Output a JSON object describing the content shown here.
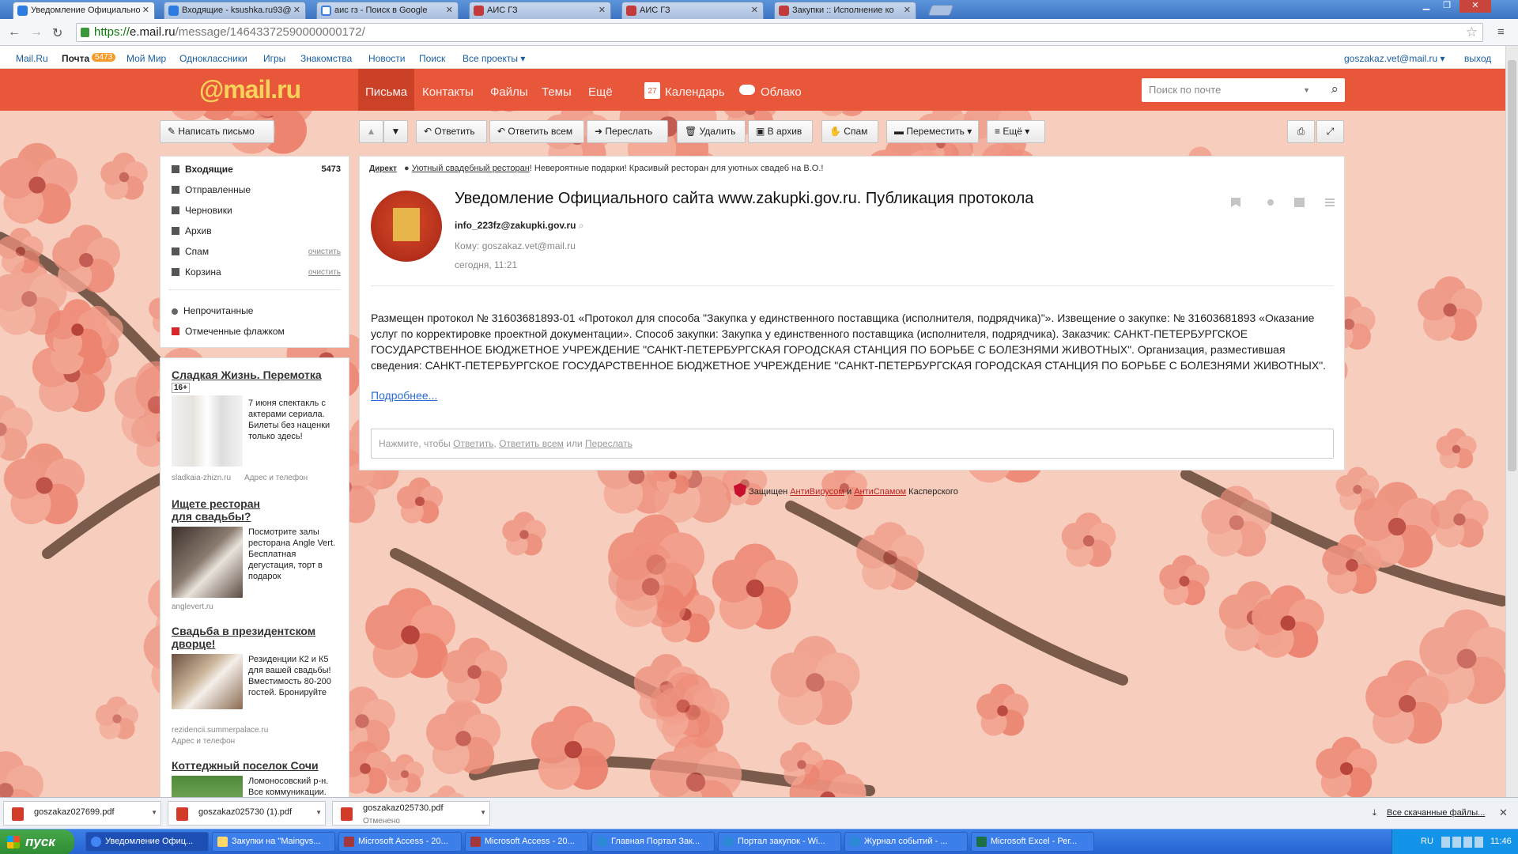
{
  "browser": {
    "tabs": [
      {
        "label": "Уведомление Официально",
        "active": true,
        "icon": "mailru-icon"
      },
      {
        "label": "Входящие - ksushka.ru93@",
        "active": false,
        "icon": "mailru-icon"
      },
      {
        "label": "аис гз - Поиск в Google",
        "active": false,
        "icon": "google-icon"
      },
      {
        "label": "АИС ГЗ",
        "active": false,
        "icon": "ais-icon"
      },
      {
        "label": "АИС ГЗ",
        "active": false,
        "icon": "ais-icon"
      },
      {
        "label": "Закупки :: Исполнение ко",
        "active": false,
        "icon": "ais-icon"
      }
    ],
    "url_scheme": "https://",
    "url_host": "e.mail.ru",
    "url_path": "/message/14643372590000000172/"
  },
  "portal": {
    "links": [
      "Mail.Ru",
      "Почта",
      "Мой Мир",
      "Одноклассники",
      "Игры",
      "Знакомства",
      "Новости",
      "Поиск",
      "Все проекты ▾"
    ],
    "mail_count": "5473",
    "user": "goszakaz.vet@mail.ru ▾",
    "logout": "выход"
  },
  "header": {
    "logo": "@mail.ru",
    "nav": [
      "Письма",
      "Контакты",
      "Файлы",
      "Темы",
      "Ещё"
    ],
    "calendar": "Календарь",
    "calendar_day": "27",
    "cloud": "Облако",
    "search_placeholder": "Поиск по почте"
  },
  "toolbar": {
    "compose": "Написать письмо",
    "reply": "Ответить",
    "reply_all": "Ответить всем",
    "forward": "Переслать",
    "delete": "Удалить",
    "archive": "В архив",
    "spam": "Спам",
    "move": "Переместить ▾",
    "more": "≡ Ещё ▾"
  },
  "folders": {
    "inbox": "Входящие",
    "inbox_count": "5473",
    "sent": "Отправленные",
    "drafts": "Черновики",
    "archive": "Архив",
    "spam": "Спам",
    "trash": "Корзина",
    "clear": "очистить",
    "unread": "Непрочитанные",
    "flagged": "Отмеченные флажком"
  },
  "ads": [
    {
      "title": "Сладкая Жизнь. Перемотка",
      "age": "16+",
      "text": "7 июня спектакль с актерами сериала. Билеты без наценки только здесь!",
      "domain": "sladkaia-zhizn.ru",
      "extra": "Адрес и телефон"
    },
    {
      "title": "Ищете ресторан для свадьбы?",
      "text": "Посмотрите залы ресторана Angle Vert. Бесплатная дегустация, торт в подарок",
      "domain": "anglevert.ru"
    },
    {
      "title": "Свадьба в президентском дворце!",
      "text": "Резиденции К2 и К5 для вашей свадьбы! Вместимость 80-200 гостей. Бронируйте",
      "domain": "rezidencii.summerpalace.ru",
      "extra": "Адрес и телефон"
    },
    {
      "title": "Коттеджный поселок Сочи",
      "text": "Ломоносовский р-н. Все коммуникации."
    }
  ],
  "message": {
    "direct_label": "Директ",
    "direct_link": "Уютный свадебный ресторан",
    "direct_text": "! Невероятные подарки! Красивый ресторан для уютных свадеб на В.О.!",
    "subject": "Уведомление Официального сайта www.zakupki.gov.ru. Публикация протокола",
    "from": "info_223fz@zakupki.gov.ru",
    "to": "Кому: goszakaz.vet@mail.ru",
    "date": "сегодня, 11:21",
    "body": "Размещен протокол № 31603681893-01 «Протокол для способа \"Закупка у единственного поставщика (исполнителя, подрядчика)\"». Извещение о закупке: № 31603681893 «Оказание услуг по корректировке проектной документации». Способ закупки: Закупка у единственного поставщика (исполнителя, подрядчика). Заказчик: САНКТ-ПЕТЕРБУРГСКОЕ ГОСУДАРСТВЕННОЕ БЮДЖЕТНОЕ УЧРЕЖДЕНИЕ \"САНКТ-ПЕТЕРБУРГСКАЯ ГОРОДСКАЯ СТАНЦИЯ ПО БОРЬБЕ С БОЛЕЗНЯМИ ЖИВОТНЫХ\". Организация, разместившая сведения: САНКТ-ПЕТЕРБУРГСКОЕ ГОСУДАРСТВЕННОЕ БЮДЖЕТНОЕ УЧРЕЖДЕНИЕ \"САНКТ-ПЕТЕРБУРГСКАЯ ГОРОДСКАЯ СТАНЦИЯ ПО БОРЬБЕ С БОЛЕЗНЯМИ ЖИВОТНЫХ\".",
    "more_link": "Подробнее...",
    "reply_prompt": "Нажмите, чтобы",
    "reply_link": "Ответить",
    "reply_all_link": "Ответить всем",
    "reply_or": "или",
    "forward_link": "Переслать"
  },
  "kaspersky": {
    "prefix": "Защищен",
    "antivirus": "АнтиВирусом",
    "and": "и",
    "antispam": "АнтиСпамом",
    "suffix": "Касперского"
  },
  "downloads": {
    "items": [
      {
        "name": "goszakaz027699.pdf",
        "status": ""
      },
      {
        "name": "goszakaz025730 (1).pdf",
        "status": ""
      },
      {
        "name": "goszakaz025730.pdf",
        "status": "Отменено"
      }
    ],
    "all_link": "Все скачанные файлы..."
  },
  "taskbar": {
    "start": "пуск",
    "tasks": [
      "Уведомление Офиц...",
      "Закупки на \"Maingvs...",
      "Microsoft Access - 20...",
      "Microsoft Access - 20...",
      "Главная Портал Зак...",
      "Портал закупок - Wi...",
      "Журнал событий - ...",
      "Microsoft Excel - Рег..."
    ],
    "lang": "RU",
    "time": "11:46"
  },
  "colors": {
    "brand": "#e8573a",
    "logo": "#f8d25a",
    "link": "#2b6bd4"
  }
}
